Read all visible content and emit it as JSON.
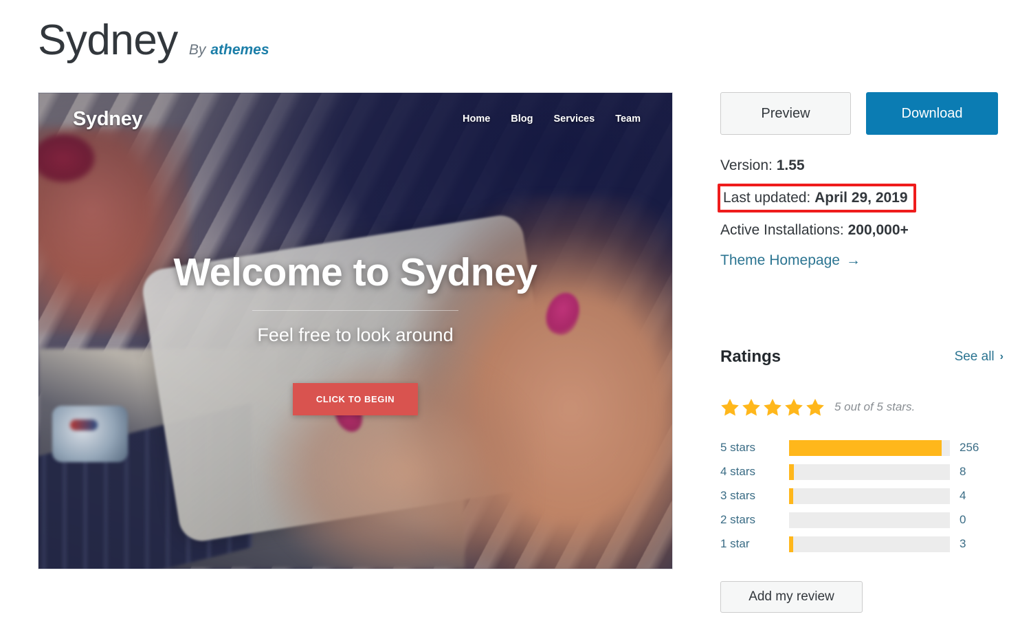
{
  "header": {
    "theme_name": "Sydney",
    "by_label": "By",
    "author": "athemes"
  },
  "screenshot": {
    "logo": "Sydney",
    "menu": [
      "Home",
      "Blog",
      "Services",
      "Team"
    ],
    "hero_title": "Welcome to Sydney",
    "hero_subtitle": "Feel free to look around",
    "hero_button": "CLICK TO BEGIN"
  },
  "actions": {
    "preview_label": "Preview",
    "download_label": "Download"
  },
  "meta": {
    "version_label": "Version:",
    "version_value": "1.55",
    "last_updated_label": "Last updated:",
    "last_updated_value": "April 29, 2019",
    "installs_label": "Active Installations:",
    "installs_value": "200,000+",
    "homepage_label": "Theme Homepage",
    "homepage_arrow": "→",
    "highlight_color": "#ef1c1c"
  },
  "ratings": {
    "title": "Ratings",
    "see_all_label": "See all",
    "see_all_chevron": "›",
    "stars_filled": 5,
    "summary": "5 out of 5 stars.",
    "star_color": "#ffb71b",
    "rows": [
      {
        "label": "5 stars",
        "count": "256",
        "percent": 95
      },
      {
        "label": "4 stars",
        "count": "8",
        "percent": 3
      },
      {
        "label": "3 stars",
        "count": "4",
        "percent": 2.5
      },
      {
        "label": "2 stars",
        "count": "0",
        "percent": 0
      },
      {
        "label": "1 star",
        "count": "3",
        "percent": 2.5
      }
    ]
  },
  "review": {
    "add_label": "Add my review"
  }
}
